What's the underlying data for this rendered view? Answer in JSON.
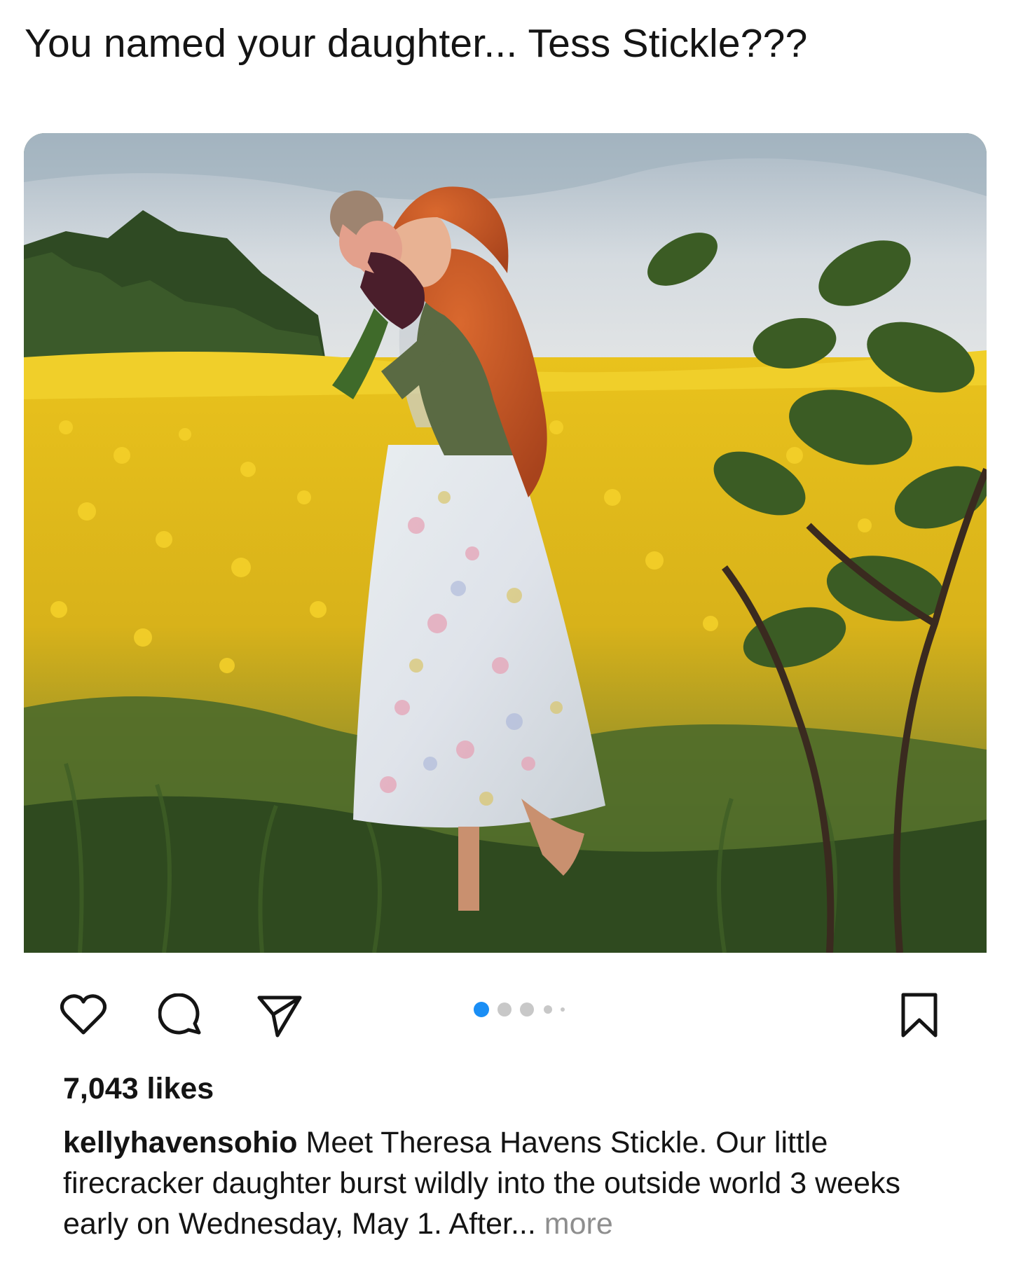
{
  "headline": "You named your daughter... Tess Stickle???",
  "post": {
    "image_alt": "Red-haired woman holding a newborn in a field of yellow wildflowers",
    "carousel": {
      "count": 5,
      "active_index": 0,
      "active_color": "#1a8ef5",
      "inactive_color": "#c8c8c8"
    },
    "actions": {
      "like_icon": "heart-icon",
      "comment_icon": "comment-icon",
      "share_icon": "paper-plane-icon",
      "save_icon": "bookmark-icon"
    },
    "likes": "7,043 likes",
    "caption": {
      "username": "kellyhavensohio",
      "text": "Meet Theresa Havens Stickle. Our little firecracker daughter burst wildly into the outside world 3 weeks early on Wednesday, May 1. After...",
      "more": "more"
    }
  }
}
